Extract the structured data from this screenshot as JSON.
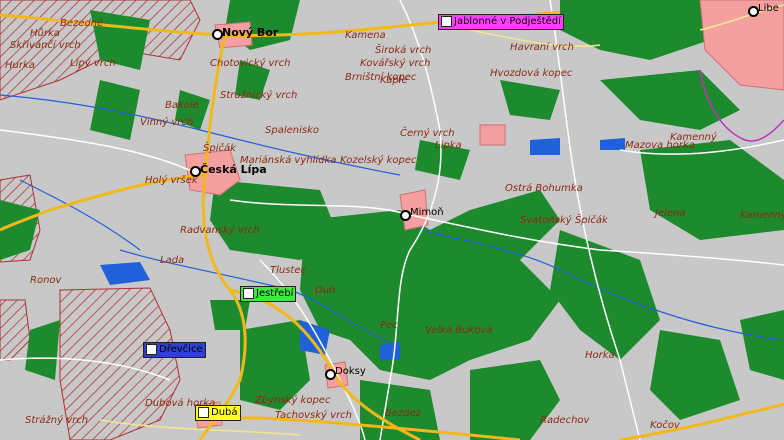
{
  "map": {
    "colors": {
      "background": "#c8c8c8",
      "forest": "#1e8a2e",
      "town": "#f4a0a0",
      "water": "#2060d8",
      "road_primary": "#f2b81a",
      "road_secondary": "#ffffff",
      "road_minor": "#f0e890",
      "contour": "#c06040",
      "restricted_hatch": "#b03030",
      "border_line": "#c030c0"
    },
    "towns": [
      {
        "name": "Nový Bor"
      },
      {
        "name": "Česká Lípa"
      },
      {
        "name": "Mimoň"
      },
      {
        "name": "Doksy"
      },
      {
        "name": "Libe"
      }
    ],
    "stations": [
      {
        "name": "Jablonné v Podještědí",
        "color": "#ff40ff"
      },
      {
        "name": "Jestřebí",
        "color": "#40e840"
      },
      {
        "name": "Dřevčice",
        "color": "#3040d0"
      },
      {
        "name": "Dubá",
        "color": "#ffff20"
      }
    ],
    "hills": [
      "Hůrka",
      "Skřivánčí vrch",
      "Bezedné",
      "Hurka",
      "Lipý vrch",
      "Chotovický vrch",
      "Stružnický vrch",
      "Bakole",
      "Vinný vrch",
      "Špičák",
      "Holý vršek",
      "Mariánská vyhlídka",
      "Radvanský vrch",
      "Spalenisko",
      "Kozelský kopec",
      "Kamena",
      "Široká vrch",
      "Kovářský vrch",
      "Brništní kopec",
      "Kaple",
      "Ronov",
      "Lada",
      "Pec",
      "Tlustec",
      "Dub",
      "Velká Buková",
      "Bezdez",
      "Radechov",
      "Kočov",
      "Zbynský kopec",
      "Tachovský vrch",
      "Dubová horka",
      "Strážný vrch",
      "Horka",
      "Ostrá Bohumka",
      "Svatoňský Špičák",
      "Lipka",
      "Černý vrch",
      "Mazova horka",
      "Jelena",
      "Kamenný",
      "Hvozdová kopec",
      "Havraní vrch",
      "Kamenný kopec"
    ]
  }
}
